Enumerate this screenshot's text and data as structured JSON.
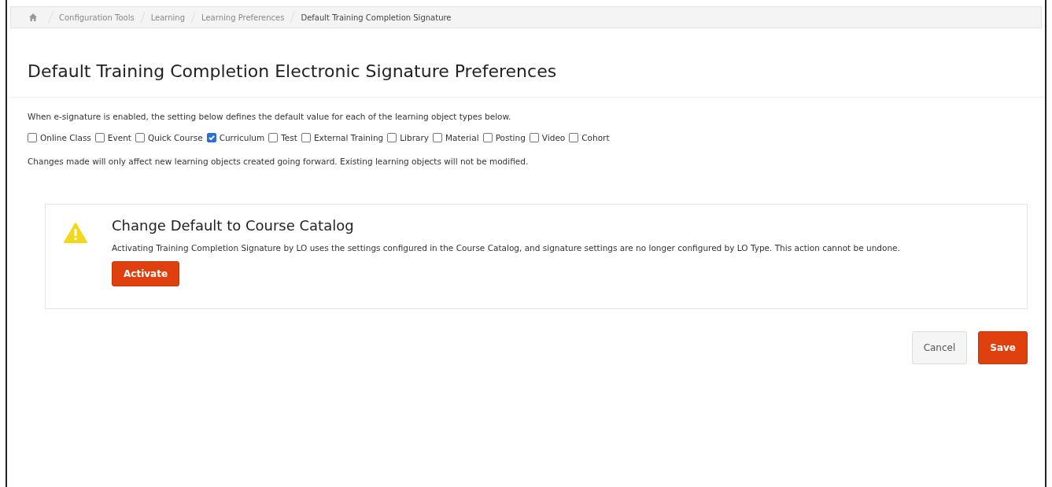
{
  "breadcrumb": [
    "Configuration Tools",
    "Learning",
    "Learning Preferences",
    "Default Training Completion Signature"
  ],
  "title": "Default Training Completion Electronic Signature Preferences",
  "intro": "When e-signature is enabled, the setting below defines the default value for each of the learning object types below.",
  "types": [
    {
      "label": "Online Class",
      "checked": false
    },
    {
      "label": "Event",
      "checked": false
    },
    {
      "label": "Quick Course",
      "checked": false
    },
    {
      "label": "Curriculum",
      "checked": true
    },
    {
      "label": "Test",
      "checked": false
    },
    {
      "label": "External Training",
      "checked": false
    },
    {
      "label": "Library",
      "checked": false
    },
    {
      "label": "Material",
      "checked": false
    },
    {
      "label": "Posting",
      "checked": false
    },
    {
      "label": "Video",
      "checked": false
    },
    {
      "label": "Cohort",
      "checked": false
    }
  ],
  "note": "Changes made will only affect new learning objects created going forward. Existing learning objects will not be modified.",
  "card": {
    "title": "Change Default to Course Catalog",
    "text": "Activating Training Completion Signature by LO uses the settings configured in the Course Catalog, and signature settings are no longer configured by LO Type. This action cannot be undone.",
    "button": "Activate"
  },
  "buttons": {
    "cancel": "Cancel",
    "save": "Save"
  }
}
